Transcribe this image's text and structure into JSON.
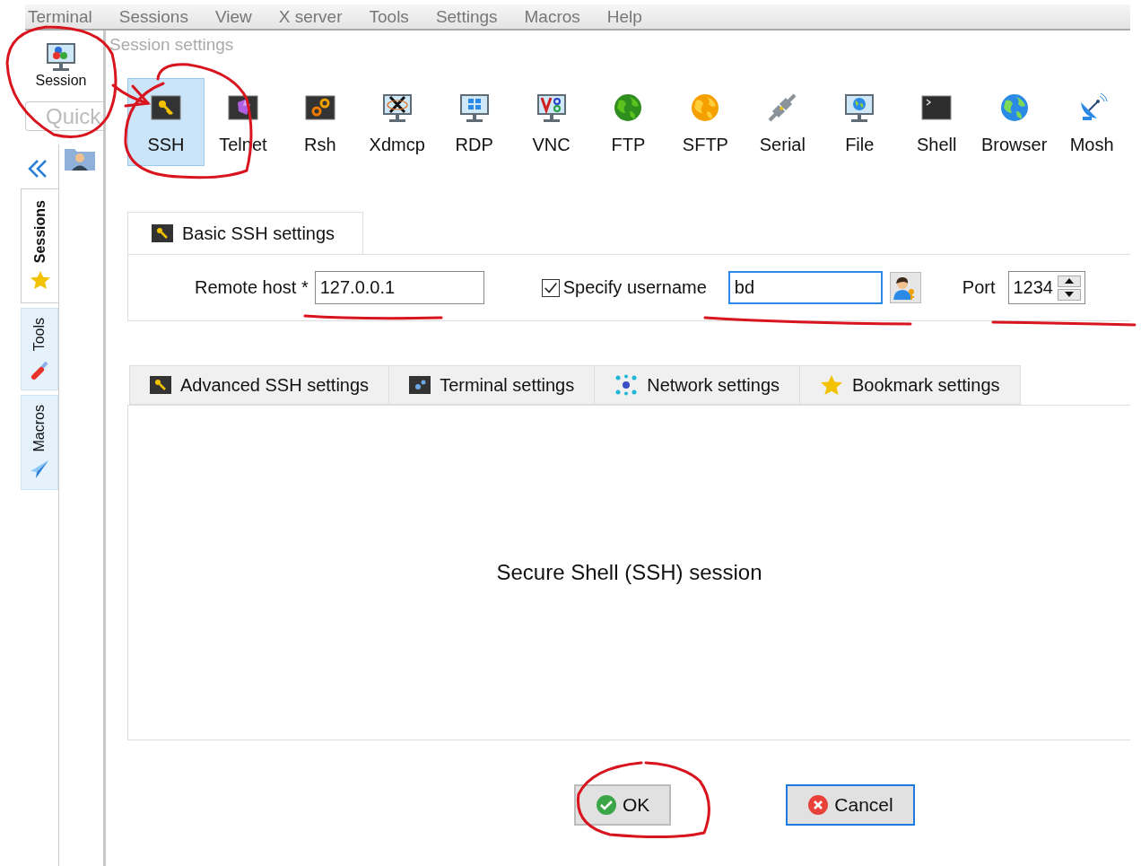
{
  "menu_bar": {
    "items": [
      "Terminal",
      "Sessions",
      "View",
      "X server",
      "Tools",
      "Settings",
      "Macros",
      "Help"
    ]
  },
  "toolbar": {
    "session_button": "Session",
    "quick_connect": {
      "placeholder": "Quick"
    }
  },
  "sidebar": {
    "tabs": [
      {
        "label": "Sessions",
        "selected": true
      },
      {
        "label": "Tools",
        "selected": false
      },
      {
        "label": "Macros",
        "selected": false
      }
    ]
  },
  "dialog": {
    "title": "Session settings",
    "session_types": [
      {
        "label": "SSH",
        "selected": true
      },
      {
        "label": "Telnet",
        "selected": false
      },
      {
        "label": "Rsh",
        "selected": false
      },
      {
        "label": "Xdmcp",
        "selected": false
      },
      {
        "label": "RDP",
        "selected": false
      },
      {
        "label": "VNC",
        "selected": false
      },
      {
        "label": "FTP",
        "selected": false
      },
      {
        "label": "SFTP",
        "selected": false
      },
      {
        "label": "Serial",
        "selected": false
      },
      {
        "label": "File",
        "selected": false
      },
      {
        "label": "Shell",
        "selected": false
      },
      {
        "label": "Browser",
        "selected": false
      },
      {
        "label": "Mosh",
        "selected": false
      }
    ],
    "basic_tab": "Basic SSH settings",
    "remote_host": {
      "label": "Remote host *",
      "value": "127.0.0.1",
      "focused": false
    },
    "specify_username": {
      "label": "Specify username",
      "checked": true,
      "value": "bd",
      "focused": true
    },
    "port": {
      "label": "Port",
      "value": "1234"
    },
    "settings_tabs": [
      "Advanced SSH settings",
      "Terminal settings",
      "Network settings",
      "Bookmark settings"
    ],
    "description": "Secure Shell (SSH) session",
    "buttons": [
      {
        "label": "OK",
        "kind": "ok",
        "focused": false
      },
      {
        "label": "Cancel",
        "kind": "cancel",
        "focused": true
      }
    ]
  }
}
